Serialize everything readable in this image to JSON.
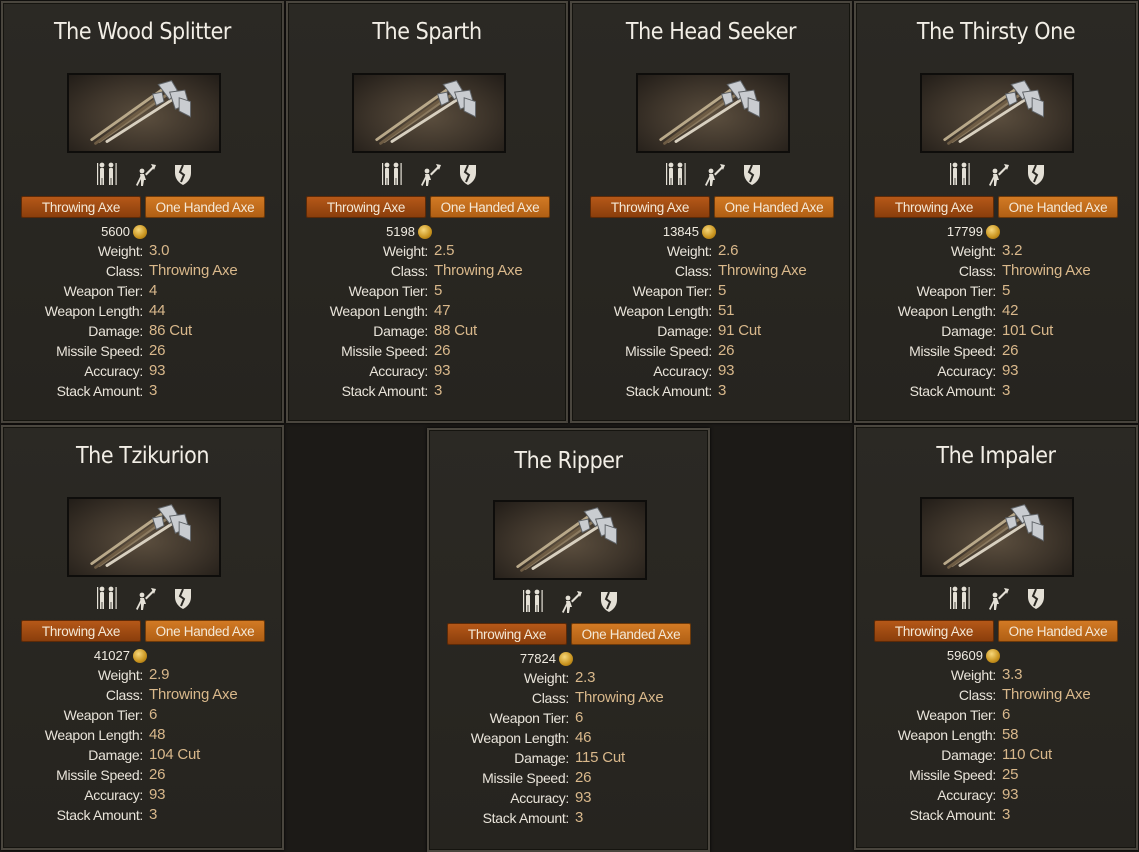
{
  "stat_labels": {
    "weight": "Weight:",
    "class": "Class:",
    "tier": "Weapon Tier:",
    "length": "Weapon Length:",
    "damage": "Damage:",
    "missile_speed": "Missile Speed:",
    "accuracy": "Accuracy:",
    "stack": "Stack Amount:"
  },
  "icons": [
    "infantry-icon",
    "throwing-icon",
    "shield-breaker-icon"
  ],
  "currency_icon": "gold-coin-icon",
  "colors": {
    "label": "#e9e4da",
    "value": "#d9b88b",
    "tag_primary": "#a24b12",
    "tag_secondary": "#c86e1e"
  },
  "cards": [
    {
      "name": "The Wood Splitter",
      "tags": [
        "Throwing Axe",
        "One Handed Axe"
      ],
      "price": "5600",
      "weight": "3.0",
      "class": "Throwing Axe",
      "tier": "4",
      "length": "44",
      "damage": "86 Cut",
      "missile_speed": "26",
      "accuracy": "93",
      "stack": "3"
    },
    {
      "name": "The Sparth",
      "tags": [
        "Throwing Axe",
        "One Handed Axe"
      ],
      "price": "5198",
      "weight": "2.5",
      "class": "Throwing Axe",
      "tier": "5",
      "length": "47",
      "damage": "88 Cut",
      "missile_speed": "26",
      "accuracy": "93",
      "stack": "3"
    },
    {
      "name": "The Head Seeker",
      "tags": [
        "Throwing Axe",
        "One Handed Axe"
      ],
      "price": "13845",
      "weight": "2.6",
      "class": "Throwing Axe",
      "tier": "5",
      "length": "51",
      "damage": "91 Cut",
      "missile_speed": "26",
      "accuracy": "93",
      "stack": "3"
    },
    {
      "name": "The Thirsty One",
      "tags": [
        "Throwing Axe",
        "One Handed Axe"
      ],
      "price": "17799",
      "weight": "3.2",
      "class": "Throwing Axe",
      "tier": "5",
      "length": "42",
      "damage": "101 Cut",
      "missile_speed": "26",
      "accuracy": "93",
      "stack": "3"
    },
    {
      "name": "The Tzikurion",
      "tags": [
        "Throwing Axe",
        "One Handed Axe"
      ],
      "price": "41027",
      "weight": "2.9",
      "class": "Throwing Axe",
      "tier": "6",
      "length": "48",
      "damage": "104 Cut",
      "missile_speed": "26",
      "accuracy": "93",
      "stack": "3"
    },
    {
      "name": "The Ripper",
      "tags": [
        "Throwing Axe",
        "One Handed Axe"
      ],
      "price": "77824",
      "weight": "2.3",
      "class": "Throwing Axe",
      "tier": "6",
      "length": "46",
      "damage": "115 Cut",
      "missile_speed": "26",
      "accuracy": "93",
      "stack": "3"
    },
    {
      "name": "The Impaler",
      "tags": [
        "Throwing Axe",
        "One Handed Axe"
      ],
      "price": "59609",
      "weight": "3.3",
      "class": "Throwing Axe",
      "tier": "6",
      "length": "58",
      "damage": "110 Cut",
      "missile_speed": "25",
      "accuracy": "93",
      "stack": "3"
    }
  ]
}
